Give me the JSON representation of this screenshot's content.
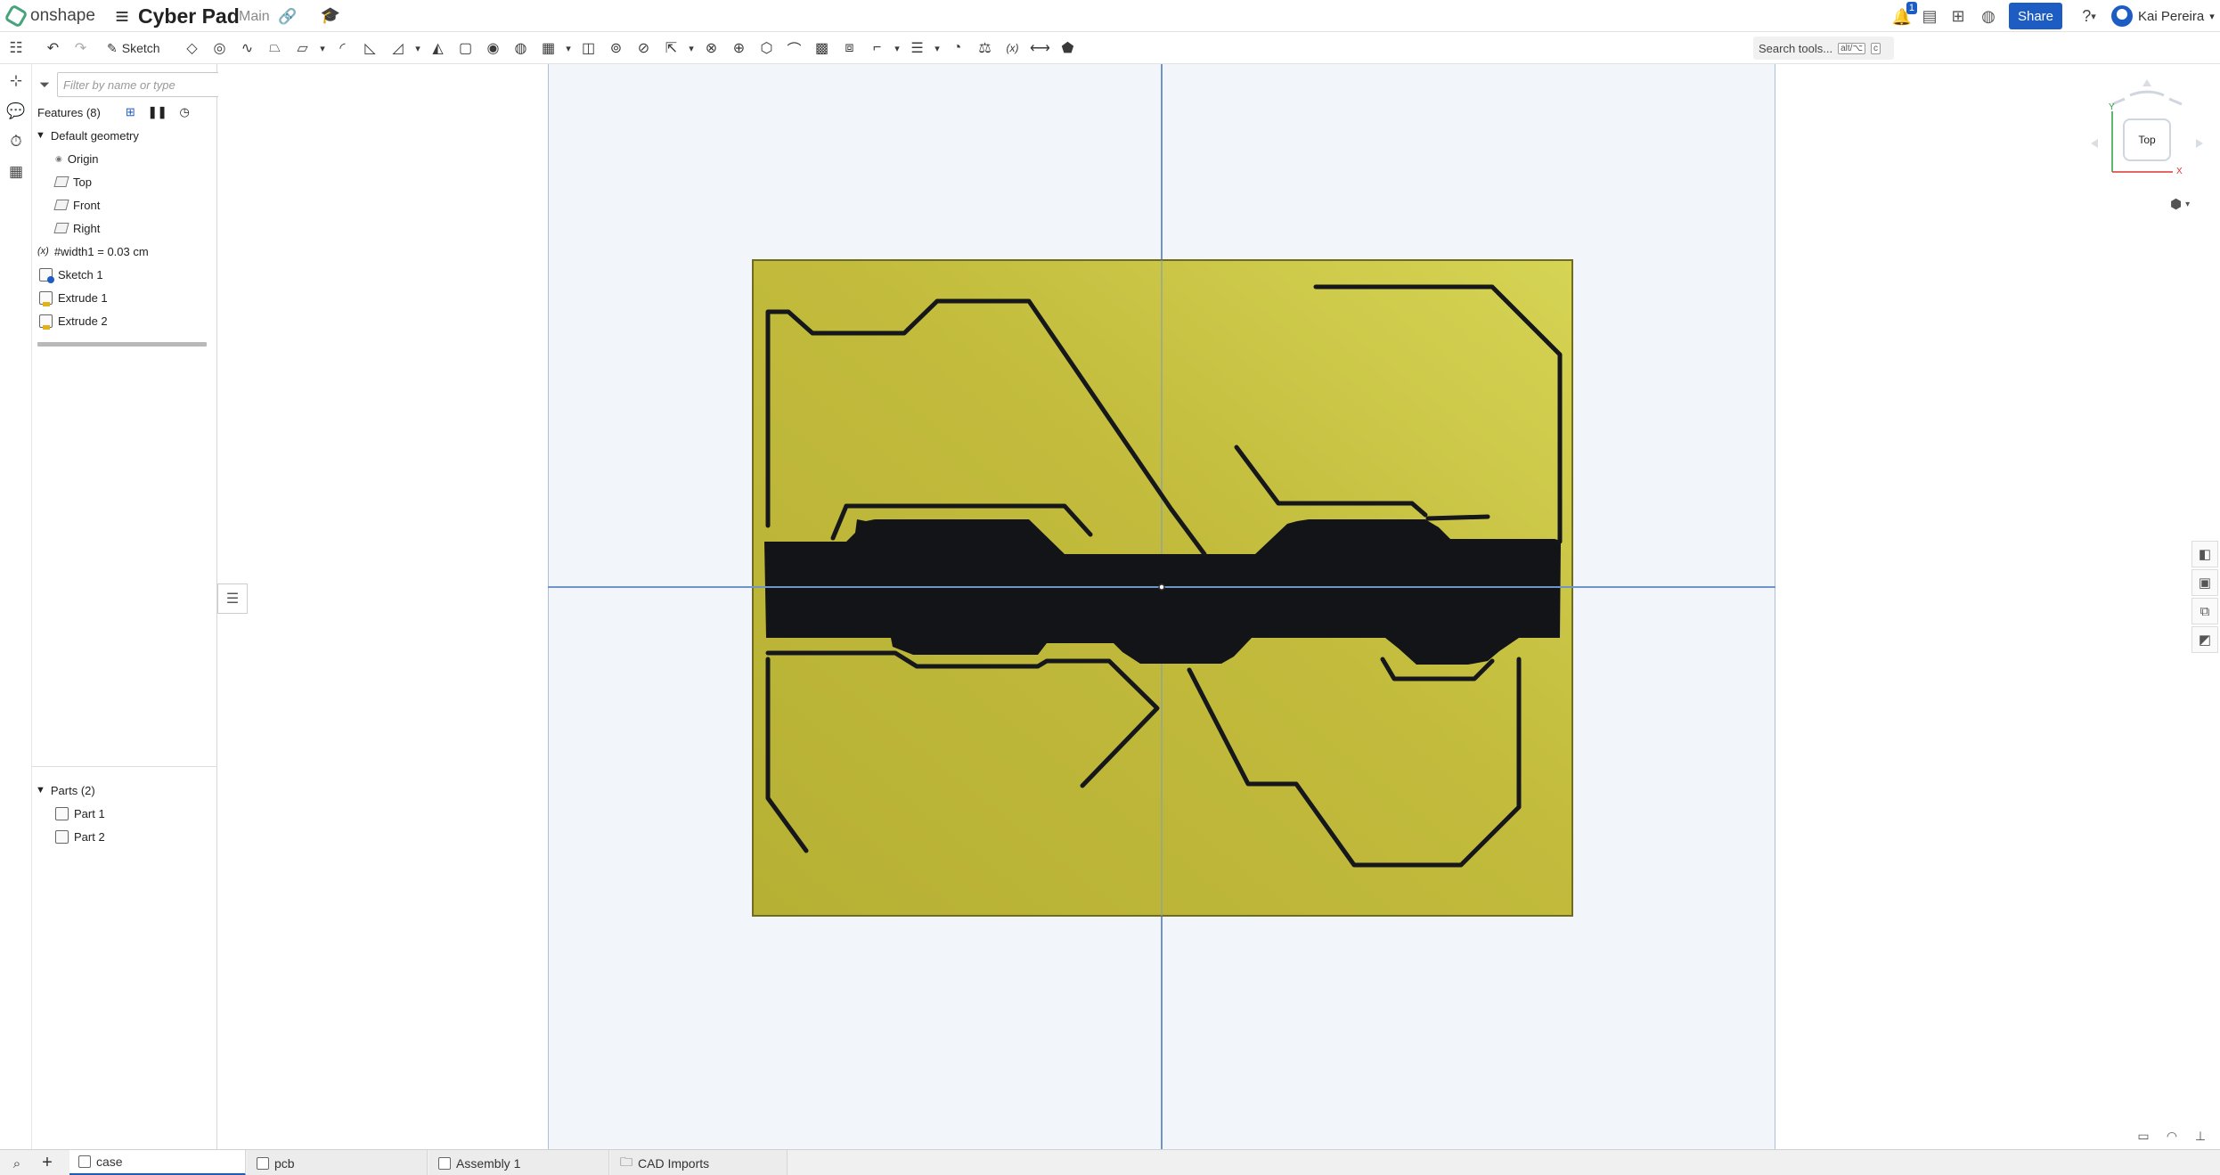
{
  "app": {
    "logo_text": "onshape",
    "doc_title": "Cyber Pad",
    "branch": "Main"
  },
  "header": {
    "notification_count": "1",
    "share_label": "Share",
    "user_name": "Kai Pereira",
    "help_glyph": "?"
  },
  "toolbar": {
    "sketch_label": "Sketch",
    "search_label": "Search tools...",
    "search_shortcut_1": "alt/⌥",
    "search_shortcut_2": "c",
    "tools": [
      "plane-icon",
      "helix-icon",
      "sweep-icon",
      "loft-icon",
      "thicken-icon",
      "dropdown",
      "fillet-icon",
      "chamfer-icon",
      "draft-icon",
      "dropdown",
      "rib-icon",
      "shell-icon",
      "hole-icon",
      "revolve-cut-icon",
      "pattern-icon",
      "dropdown",
      "mirror-icon",
      "boolean-icon",
      "split-icon",
      "transform-icon",
      "dropdown",
      "delete-icon",
      "mate-connector-icon",
      "plane-offset-icon",
      "wrap-icon",
      "emboss-icon",
      "sheet-metal-icon",
      "flange-icon",
      "dropdown",
      "list-icon",
      "dropdown",
      "measure-icon",
      "mass-icon",
      "variable-icon",
      "dimension-icon",
      "tag-icon"
    ]
  },
  "feature_panel": {
    "filter_placeholder": "Filter by name or type",
    "features_header": "Features (8)",
    "default_geometry": "Default geometry",
    "origin": "Origin",
    "top": "Top",
    "front": "Front",
    "right": "Right",
    "variable": "#width1 = 0.03 cm",
    "sketch1": "Sketch 1",
    "extrude1": "Extrude 1",
    "extrude2": "Extrude 2",
    "parts_header": "Parts (2)",
    "part1": "Part 1",
    "part2": "Part 2"
  },
  "viewcube": {
    "face_label": "Top",
    "axis_y": "Y",
    "axis_x": "X"
  },
  "tabs": [
    {
      "label": "case",
      "active": true
    },
    {
      "label": "pcb",
      "active": false
    },
    {
      "label": "Assembly 1",
      "active": false
    },
    {
      "label": "CAD Imports",
      "active": false
    }
  ],
  "colors": {
    "accent": "#1d5cc2",
    "part_fill": "#c2bb3c",
    "cutout": "#121418",
    "sketch_bg": "#f2f5f9",
    "axis_line": "#6f94c8"
  }
}
